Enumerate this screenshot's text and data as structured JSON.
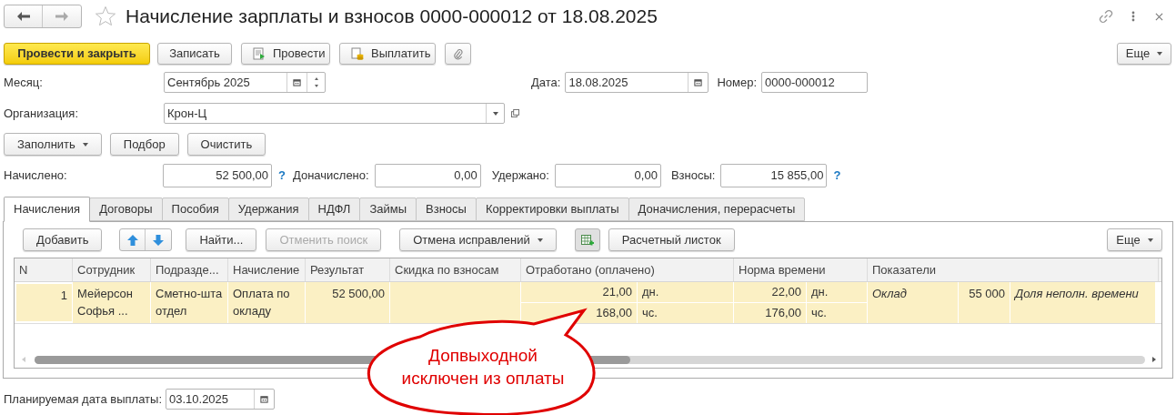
{
  "window": {
    "title": "Начисление зарплаты и взносов 0000-000012 от 18.08.2025",
    "favorite": false
  },
  "command_bar": [
    {
      "kind": "primary",
      "label": "Провести и закрыть"
    },
    {
      "kind": "plain",
      "label": "Записать"
    },
    {
      "kind": "post",
      "label": "Провести"
    },
    {
      "kind": "pay",
      "label": "Выплатить"
    },
    {
      "kind": "attach"
    }
  ],
  "more_button": "Еще",
  "month": {
    "label": "Месяц:",
    "value": "Сентябрь 2025"
  },
  "date": {
    "label": "Дата:",
    "value": "18.08.2025"
  },
  "number": {
    "label": "Номер:",
    "value": "0000-000012"
  },
  "organization": {
    "label": "Организация:",
    "value": "Крон-Ц"
  },
  "fill_buttons": [
    {
      "label": "Заполнить",
      "dropdown": true
    },
    {
      "label": "Подбор",
      "dropdown": false
    },
    {
      "label": "Очистить",
      "dropdown": false
    }
  ],
  "totals": [
    {
      "label": "Начислено:",
      "value": "52 500,00",
      "help": "?"
    },
    {
      "label": "Доначислено:",
      "value": "0,00"
    },
    {
      "label": "Удержано:",
      "value": "0,00"
    },
    {
      "label": "Взносы:",
      "value": "15 855,00",
      "help": "?"
    }
  ],
  "tabs": [
    {
      "label": "Начисления",
      "selected": true
    },
    {
      "label": "Договоры",
      "selected": false
    },
    {
      "label": "Пособия",
      "selected": false
    },
    {
      "label": "Удержания",
      "selected": false
    },
    {
      "label": "НДФЛ",
      "selected": false
    },
    {
      "label": "Займы",
      "selected": false
    },
    {
      "label": "Взносы",
      "selected": false
    },
    {
      "label": "Корректировки выплаты",
      "selected": false
    },
    {
      "label": "Доначисления, перерасчеты",
      "selected": false
    }
  ],
  "table_toolbar": [
    {
      "kind": "text",
      "label": "Добавить",
      "disabled": false
    },
    {
      "kind": "updown"
    },
    {
      "kind": "text",
      "label": "Найти...",
      "disabled": false
    },
    {
      "kind": "text",
      "label": "Отменить поиск",
      "disabled": true
    },
    {
      "kind": "dropdown",
      "label": "Отмена исправлений",
      "disabled": false
    },
    {
      "kind": "grid-add"
    },
    {
      "kind": "text",
      "label": "Расчетный листок",
      "disabled": false
    }
  ],
  "table_more_button": "Еще",
  "table": {
    "columns": [
      "N",
      "Сотрудник",
      "Подразде...",
      "Начисление",
      "Результат",
      "Скидка по взносам",
      "Отработано (оплачено)",
      "Норма времени",
      "Показатели"
    ],
    "rows": [
      {
        "selected": true,
        "n": "1",
        "employee": "Мейерсон Софья ...",
        "department": "Сметно-шта отдел",
        "accrual": "Оплата по окладу",
        "result": "52 500,00",
        "worked": [
          {
            "value": "21,00",
            "unit": "дн."
          },
          {
            "value": "168,00",
            "unit": "чс."
          }
        ],
        "norm": [
          {
            "value": "22,00",
            "unit": "дн."
          },
          {
            "value": "176,00",
            "unit": "чс."
          }
        ],
        "indicators": [
          {
            "kind": "name",
            "text": "Оклад"
          },
          {
            "kind": "value",
            "text": "55 000"
          },
          {
            "kind": "name",
            "text": "Доля неполн. времени"
          }
        ]
      }
    ]
  },
  "payment_date": {
    "label": "Планируемая дата выплаты:",
    "value": "03.10.2025"
  },
  "callout": "Допвыходной исключен из оплаты"
}
